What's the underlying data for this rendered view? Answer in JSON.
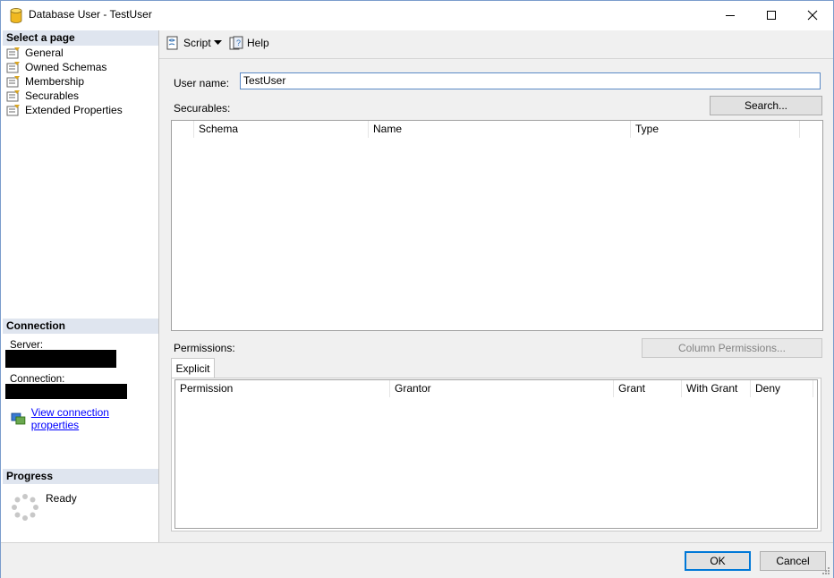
{
  "window": {
    "title": "Database User - TestUser"
  },
  "left_pane": {
    "select_page_header": "Select a page",
    "pages": [
      {
        "label": "General"
      },
      {
        "label": "Owned Schemas"
      },
      {
        "label": "Membership"
      },
      {
        "label": "Securables"
      },
      {
        "label": "Extended Properties"
      }
    ],
    "connection_header": "Connection",
    "server_label": "Server:",
    "connection_label": "Connection:",
    "view_connection_link": "View connection properties",
    "progress_header": "Progress",
    "progress_status": "Ready"
  },
  "toolbar": {
    "script_label": "Script",
    "help_label": "Help"
  },
  "form": {
    "user_name_label": "User name:",
    "user_name_value": "TestUser",
    "securables_label": "Securables:",
    "search_button": "Search...",
    "securables_columns": [
      "Schema",
      "Name",
      "Type"
    ],
    "permissions_label": "Permissions:",
    "column_permissions_button": "Column Permissions...",
    "explicit_tab": "Explicit",
    "permissions_columns": [
      "Permission",
      "Grantor",
      "Grant",
      "With Grant",
      "Deny"
    ]
  },
  "footer": {
    "ok_button": "OK",
    "cancel_button": "Cancel"
  },
  "colors": {
    "section_header_bg": "#dfe5ef",
    "link": "#0000ff",
    "accent": "#0078d7"
  }
}
